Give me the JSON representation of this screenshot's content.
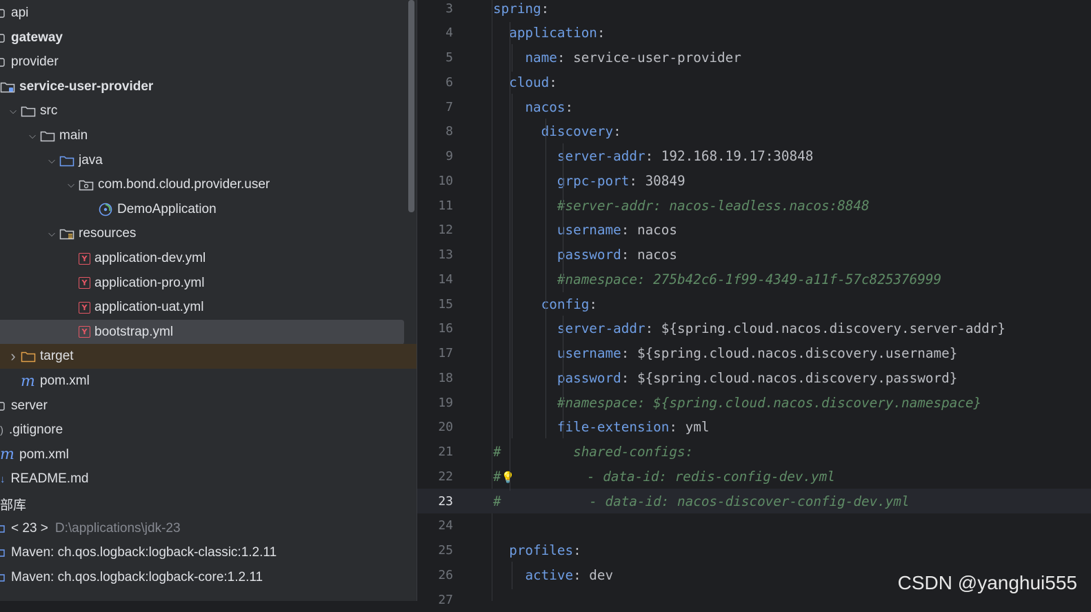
{
  "tree": [
    {
      "label": "api",
      "indent": 0,
      "icon": "module-icon",
      "arrow": "",
      "bold": false
    },
    {
      "label": "gateway",
      "indent": 0,
      "icon": "module-icon",
      "arrow": "",
      "bold": true
    },
    {
      "label": "provider",
      "indent": 0,
      "icon": "module-icon",
      "arrow": "",
      "bold": false
    },
    {
      "label": "service-user-provider",
      "indent": 0,
      "icon": "module-folder-icon",
      "arrow": "",
      "bold": true
    },
    {
      "label": "src",
      "indent": 1,
      "icon": "folder-icon",
      "arrow": "expanded",
      "bold": false
    },
    {
      "label": "main",
      "indent": 2,
      "icon": "folder-icon",
      "arrow": "expanded",
      "bold": false
    },
    {
      "label": "java",
      "indent": 3,
      "icon": "source-folder-icon",
      "arrow": "expanded",
      "bold": false
    },
    {
      "label": "com.bond.cloud.provider.user",
      "indent": 4,
      "icon": "package-icon",
      "arrow": "expanded",
      "bold": false
    },
    {
      "label": "DemoApplication",
      "indent": 5,
      "icon": "spring-boot-icon",
      "arrow": "",
      "bold": false
    },
    {
      "label": "resources",
      "indent": 3,
      "icon": "resources-folder-icon",
      "arrow": "expanded",
      "bold": false
    },
    {
      "label": "application-dev.yml",
      "indent": 4,
      "icon": "yaml-file-icon",
      "arrow": "",
      "bold": false
    },
    {
      "label": "application-pro.yml",
      "indent": 4,
      "icon": "yaml-file-icon",
      "arrow": "",
      "bold": false
    },
    {
      "label": "application-uat.yml",
      "indent": 4,
      "icon": "yaml-file-icon",
      "arrow": "",
      "bold": false
    },
    {
      "label": "bootstrap.yml",
      "indent": 4,
      "icon": "yaml-file-icon",
      "arrow": "",
      "bold": false,
      "selected": true
    },
    {
      "label": "target",
      "indent": 1,
      "icon": "excluded-folder-icon",
      "arrow": "collapsed",
      "bold": false,
      "excluded": true
    },
    {
      "label": "pom.xml",
      "indent": 1,
      "icon": "maven-icon",
      "arrow": "",
      "bold": false
    },
    {
      "label": "server",
      "indent": 0,
      "icon": "module-icon",
      "arrow": "",
      "bold": false
    },
    {
      "label": ".gitignore",
      "indent": 0,
      "icon": "ignore-file-icon",
      "arrow": "",
      "bold": false
    },
    {
      "label": "pom.xml",
      "indent": 0,
      "icon": "maven-icon",
      "arrow": "",
      "bold": false
    },
    {
      "label": "README.md",
      "indent": 0,
      "icon": "markdown-icon",
      "arrow": "",
      "bold": false
    },
    {
      "label": "部库",
      "indent": 0,
      "icon": "",
      "arrow": "",
      "bold": false
    },
    {
      "label": "< 23 >",
      "extra": "D:\\applications\\jdk-23",
      "indent": 0,
      "icon": "library-icon",
      "arrow": "",
      "bold": false
    },
    {
      "label": "Maven: ch.qos.logback:logback-classic:1.2.11",
      "indent": 0,
      "icon": "library-icon",
      "arrow": "",
      "bold": false
    },
    {
      "label": "Maven: ch.qos.logback:logback-core:1.2.11",
      "indent": 0,
      "icon": "library-icon",
      "arrow": "",
      "bold": false
    }
  ],
  "editor": {
    "current_line": "23",
    "lines": [
      {
        "n": "3",
        "parts": [
          {
            "t": "spring",
            "c": "k"
          },
          {
            "t": ":",
            "c": "v"
          }
        ]
      },
      {
        "n": "4",
        "parts": [
          {
            "t": "  "
          },
          {
            "t": "application",
            "c": "k"
          },
          {
            "t": ":",
            "c": "v"
          }
        ]
      },
      {
        "n": "5",
        "parts": [
          {
            "t": "    "
          },
          {
            "t": "name",
            "c": "k"
          },
          {
            "t": ": service-user-provider",
            "c": "v"
          }
        ]
      },
      {
        "n": "6",
        "parts": [
          {
            "t": "  "
          },
          {
            "t": "cloud",
            "c": "k"
          },
          {
            "t": ":",
            "c": "v"
          }
        ]
      },
      {
        "n": "7",
        "parts": [
          {
            "t": "    "
          },
          {
            "t": "nacos",
            "c": "k"
          },
          {
            "t": ":",
            "c": "v"
          }
        ]
      },
      {
        "n": "8",
        "parts": [
          {
            "t": "      "
          },
          {
            "t": "discovery",
            "c": "k"
          },
          {
            "t": ":",
            "c": "v"
          }
        ]
      },
      {
        "n": "9",
        "parts": [
          {
            "t": "        "
          },
          {
            "t": "server-addr",
            "c": "k"
          },
          {
            "t": ": 192.168.19.17:30848",
            "c": "v"
          }
        ]
      },
      {
        "n": "10",
        "parts": [
          {
            "t": "        "
          },
          {
            "t": "grpc-port",
            "c": "k"
          },
          {
            "t": ": 30849",
            "c": "v"
          }
        ]
      },
      {
        "n": "11",
        "parts": [
          {
            "t": "        "
          },
          {
            "t": "#server-addr: nacos-leadless.nacos:8848",
            "c": "c"
          }
        ]
      },
      {
        "n": "12",
        "parts": [
          {
            "t": "        "
          },
          {
            "t": "username",
            "c": "k"
          },
          {
            "t": ": nacos",
            "c": "v"
          }
        ]
      },
      {
        "n": "13",
        "parts": [
          {
            "t": "        "
          },
          {
            "t": "password",
            "c": "k"
          },
          {
            "t": ": nacos",
            "c": "v"
          }
        ]
      },
      {
        "n": "14",
        "parts": [
          {
            "t": "        "
          },
          {
            "t": "#namespace: 275b42c6-1f99-4349-a11f-57c825376999",
            "c": "c"
          }
        ]
      },
      {
        "n": "15",
        "parts": [
          {
            "t": "      "
          },
          {
            "t": "config",
            "c": "k"
          },
          {
            "t": ":",
            "c": "v"
          }
        ]
      },
      {
        "n": "16",
        "parts": [
          {
            "t": "        "
          },
          {
            "t": "server-addr",
            "c": "k"
          },
          {
            "t": ": ${spring.cloud.nacos.discovery.server-addr}",
            "c": "v"
          }
        ]
      },
      {
        "n": "17",
        "parts": [
          {
            "t": "        "
          },
          {
            "t": "username",
            "c": "k"
          },
          {
            "t": ": ${spring.cloud.nacos.discovery.username}",
            "c": "v"
          }
        ]
      },
      {
        "n": "18",
        "parts": [
          {
            "t": "        "
          },
          {
            "t": "password",
            "c": "k"
          },
          {
            "t": ": ${spring.cloud.nacos.discovery.password}",
            "c": "v"
          }
        ]
      },
      {
        "n": "19",
        "parts": [
          {
            "t": "        "
          },
          {
            "t": "#namespace: ${spring.cloud.nacos.discovery.namespace}",
            "c": "c"
          }
        ]
      },
      {
        "n": "20",
        "parts": [
          {
            "t": "        "
          },
          {
            "t": "file-extension",
            "c": "k"
          },
          {
            "t": ": yml",
            "c": "v"
          }
        ]
      },
      {
        "n": "21",
        "parts": [
          {
            "t": "#         shared-configs:",
            "c": "c"
          }
        ]
      },
      {
        "n": "22",
        "parts": [
          {
            "t": "#",
            "c": "c"
          },
          {
            "t": "💡",
            "c": "bulb"
          },
          {
            "t": "         - data-id: redis-config-dev.yml",
            "c": "c"
          }
        ]
      },
      {
        "n": "23",
        "parts": [
          {
            "t": "#           - data-id: nacos-discover-config-dev.yml",
            "c": "c"
          }
        ]
      },
      {
        "n": "24",
        "parts": []
      },
      {
        "n": "25",
        "parts": [
          {
            "t": "  "
          },
          {
            "t": "profiles",
            "c": "k"
          },
          {
            "t": ":",
            "c": "v"
          }
        ]
      },
      {
        "n": "26",
        "parts": [
          {
            "t": "    "
          },
          {
            "t": "active",
            "c": "k"
          },
          {
            "t": ": dev",
            "c": "v"
          }
        ]
      },
      {
        "n": "27",
        "parts": []
      }
    ]
  },
  "watermark": "CSDN @yanghui555",
  "colors": {
    "key": "#6f9ee5",
    "comment": "#5f8c66",
    "value": "#bcbec4",
    "selection": "#43454a"
  }
}
